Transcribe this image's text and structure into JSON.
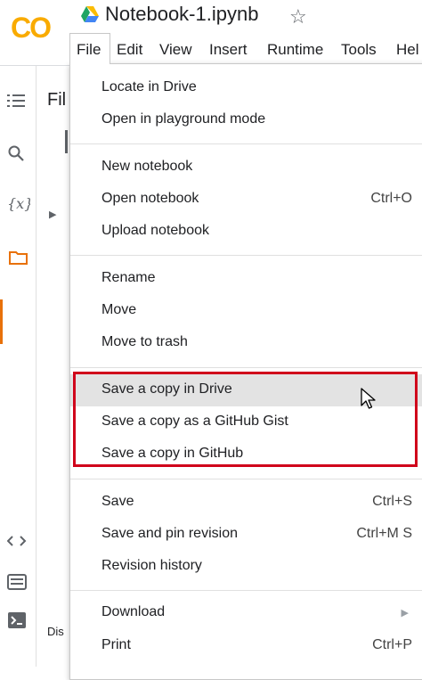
{
  "header": {
    "logo_text": "CO",
    "doc_title": "Notebook-1.ipynb",
    "menu": [
      "File",
      "Edit",
      "View",
      "Insert",
      "Runtime",
      "Tools",
      "Hel"
    ]
  },
  "sidebar": {
    "title": "Fil",
    "footer_text": "Dis"
  },
  "file_menu": {
    "items": [
      {
        "label": "Locate in Drive",
        "shortcut": ""
      },
      {
        "label": "Open in playground mode",
        "shortcut": ""
      },
      {
        "label": "New notebook",
        "shortcut": ""
      },
      {
        "label": "Open notebook",
        "shortcut": "Ctrl+O"
      },
      {
        "label": "Upload notebook",
        "shortcut": ""
      },
      {
        "label": "Rename",
        "shortcut": ""
      },
      {
        "label": "Move",
        "shortcut": ""
      },
      {
        "label": "Move to trash",
        "shortcut": ""
      },
      {
        "label": "Save a copy in Drive",
        "shortcut": ""
      },
      {
        "label": "Save a copy as a GitHub Gist",
        "shortcut": ""
      },
      {
        "label": "Save a copy in GitHub",
        "shortcut": ""
      },
      {
        "label": "Save",
        "shortcut": "Ctrl+S"
      },
      {
        "label": "Save and pin revision",
        "shortcut": "Ctrl+M S"
      },
      {
        "label": "Revision history",
        "shortcut": ""
      },
      {
        "label": "Download",
        "shortcut": ""
      },
      {
        "label": "Print",
        "shortcut": "Ctrl+P"
      }
    ]
  },
  "colors": {
    "highlight_box": "#d0021b",
    "hover_bg": "#e3e3e3",
    "accent": "#e8710a"
  }
}
